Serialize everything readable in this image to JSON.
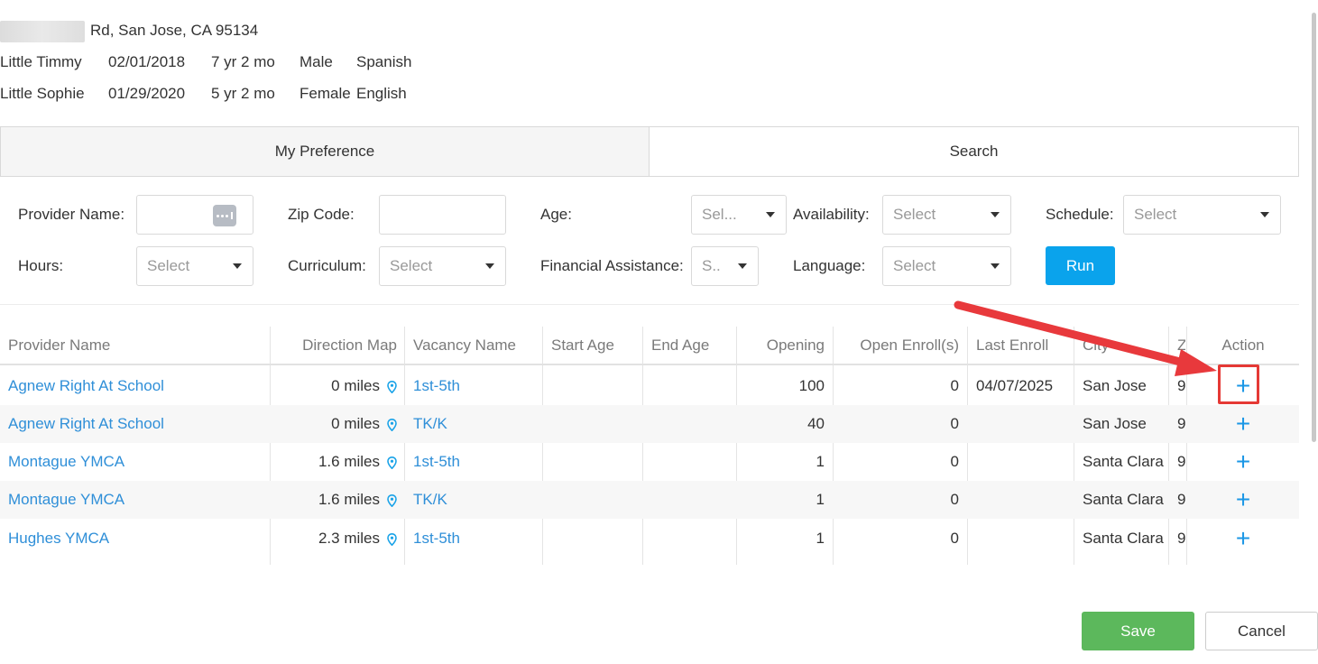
{
  "family": {
    "address": "Rd, San Jose, CA 95134",
    "children": [
      {
        "name": "Little Timmy",
        "dob": "02/01/2018",
        "age": "7 yr 2 mo",
        "gender": "Male",
        "language": "Spanish"
      },
      {
        "name": "Little Sophie",
        "dob": "01/29/2020",
        "age": "5 yr 2 mo",
        "gender": "Female",
        "language": "English"
      }
    ]
  },
  "tabs": {
    "my_preference": "My Preference",
    "search": "Search"
  },
  "filters": {
    "provider_name": "Provider Name:",
    "zip_code": "Zip Code:",
    "age": "Age:",
    "age_value": "Sel...",
    "availability": "Availability:",
    "availability_value": "Select",
    "schedule": "Schedule:",
    "schedule_value": "Select",
    "hours": "Hours:",
    "hours_value": "Select",
    "curriculum": "Curriculum:",
    "curriculum_value": "Select",
    "financial_assistance": "Financial Assistance:",
    "financial_assistance_value": "S..",
    "language": "Language:",
    "language_value": "Select",
    "run": "Run"
  },
  "table": {
    "headers": {
      "provider_name": "Provider Name",
      "direction_map": "Direction Map",
      "vacancy_name": "Vacancy Name",
      "start_age": "Start Age",
      "end_age": "End Age",
      "opening": "Opening",
      "open_enrolls": "Open Enroll(s)",
      "last_enroll": "Last Enroll",
      "city": "City",
      "zip": "Z",
      "action": "Action"
    },
    "rows": [
      {
        "provider": "Agnew Right At School",
        "distance": "0 miles",
        "vacancy": "1st-5th",
        "start_age": "",
        "end_age": "",
        "opening": "100",
        "open_enrolls": "0",
        "last_enroll": "04/07/2025",
        "city": "San Jose",
        "zip": "9",
        "action": "+"
      },
      {
        "provider": "Agnew Right At School",
        "distance": "0 miles",
        "vacancy": "TK/K",
        "start_age": "",
        "end_age": "",
        "opening": "40",
        "open_enrolls": "0",
        "last_enroll": "",
        "city": "San Jose",
        "zip": "9",
        "action": "+"
      },
      {
        "provider": "Montague YMCA",
        "distance": "1.6 miles",
        "vacancy": "1st-5th",
        "start_age": "",
        "end_age": "",
        "opening": "1",
        "open_enrolls": "0",
        "last_enroll": "",
        "city": "Santa Clara",
        "zip": "9",
        "action": "+"
      },
      {
        "provider": "Montague YMCA",
        "distance": "1.6 miles",
        "vacancy": "TK/K",
        "start_age": "",
        "end_age": "",
        "opening": "1",
        "open_enrolls": "0",
        "last_enroll": "",
        "city": "Santa Clara",
        "zip": "9",
        "action": "+"
      },
      {
        "provider": "Hughes YMCA",
        "distance": "2.3 miles",
        "vacancy": "1st-5th",
        "start_age": "",
        "end_age": "",
        "opening": "1",
        "open_enrolls": "0",
        "last_enroll": "",
        "city": "Santa Clara",
        "zip": "9",
        "action": "+"
      }
    ]
  },
  "footer": {
    "save": "Save",
    "cancel": "Cancel"
  },
  "colors": {
    "link": "#2f8fd8",
    "run_button": "#0aa3ec",
    "save_button": "#5cb85c",
    "highlight": "#e53935",
    "annotation_arrow": "#e8393c"
  },
  "icons": {
    "pin": "map-pin-icon",
    "more": "more-dots-icon",
    "add": "plus-icon",
    "caret": "caret-down-icon"
  }
}
